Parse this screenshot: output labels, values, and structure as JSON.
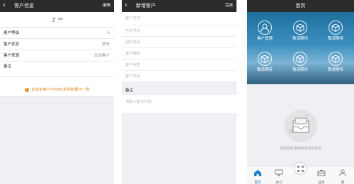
{
  "screen1": {
    "nav_title": "客户信息",
    "nav_right": "编辑",
    "customer_name": "丁 **",
    "rows": [
      {
        "label": "客户等级",
        "value": "A"
      },
      {
        "label": "客户状态",
        "value": "签单"
      },
      {
        "label": "客户来源",
        "value": "忠诚客户"
      }
    ],
    "note_label": "备注",
    "warning": "此签单用户与WMS系统数据不一致"
  },
  "screen2": {
    "nav_title": "新增客户",
    "nav_right": "完成",
    "fields": [
      "客户名称",
      "手机号码",
      "固定电话",
      "客户等级",
      "客户状态",
      "客户来源"
    ],
    "note_label": "备注",
    "note_placeholder": "请输入备注内容"
  },
  "screen3": {
    "nav_title": "首页",
    "tiles": [
      {
        "label": "客户管理",
        "icon": "person-icon"
      },
      {
        "label": "敬请期待",
        "icon": "box-icon"
      },
      {
        "label": "敬请期待",
        "icon": "box-icon"
      },
      {
        "label": "敬请期待",
        "icon": "box-icon"
      },
      {
        "label": "敬请期待",
        "icon": "box-icon"
      },
      {
        "label": "敬请期待",
        "icon": "box-icon"
      }
    ],
    "empty_message": "空空如也,暂时没有任何任务",
    "tabs": [
      {
        "label": "首页",
        "icon": "home-icon",
        "active": true
      },
      {
        "label": "办公",
        "icon": "monitor-icon",
        "active": false
      },
      {
        "label": "",
        "icon": "apps-icon",
        "active": false
      },
      {
        "label": "业务",
        "icon": "briefcase-icon",
        "active": false
      },
      {
        "label": "我",
        "icon": "user-icon",
        "active": false
      }
    ]
  },
  "colors": {
    "nav_bg": "#2b2b2b",
    "warning": "#e08a1e",
    "active_tab": "#1f7fc8",
    "hero": "#2a7fb0"
  }
}
